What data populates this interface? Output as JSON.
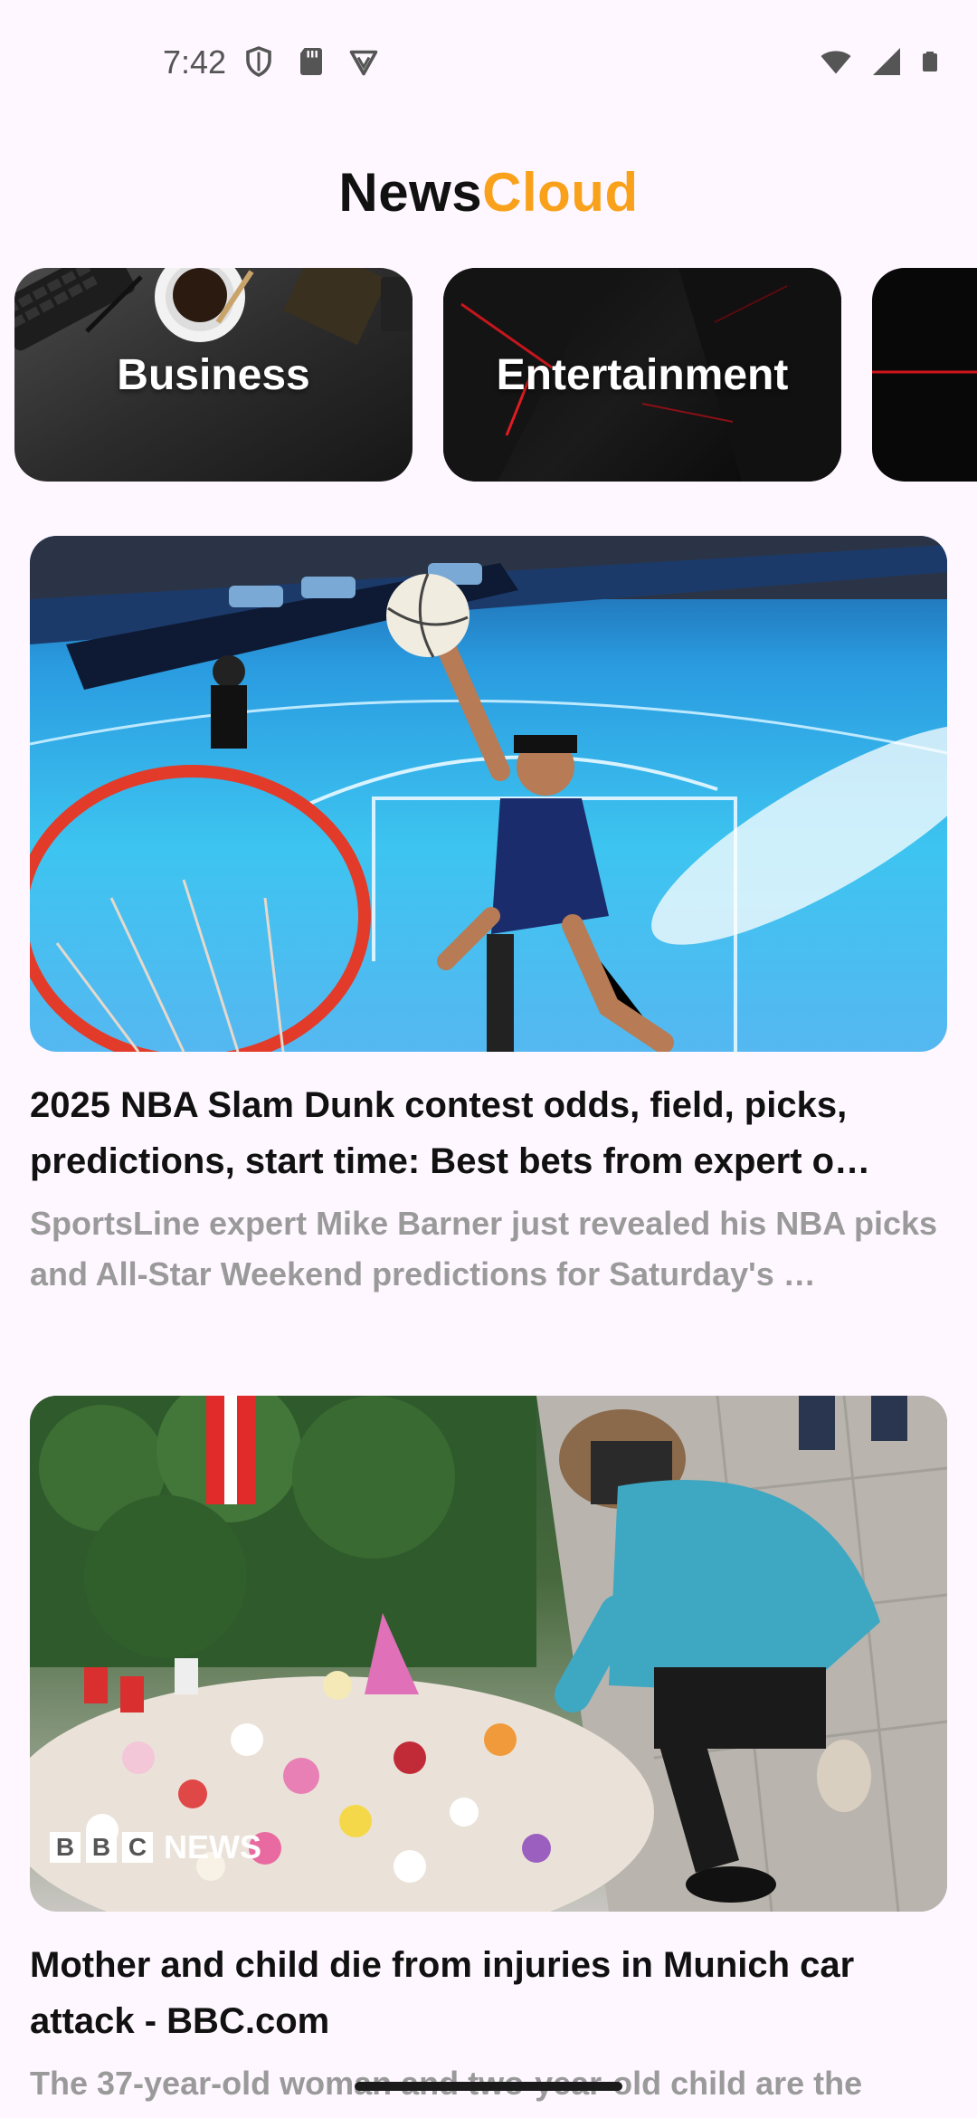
{
  "status_bar": {
    "time": "7:42",
    "left_icons": [
      "shield-icon",
      "sd-card-icon",
      "vpn-badge-icon"
    ],
    "right_icons": [
      "wifi-icon",
      "cellular-signal-icon",
      "battery-icon"
    ]
  },
  "app": {
    "title_part1": "News",
    "title_part2": "Cloud",
    "accent_color": "#F9A11B"
  },
  "categories": [
    {
      "label": "Business"
    },
    {
      "label": "Entertainment"
    },
    {
      "label": ""
    }
  ],
  "articles": [
    {
      "title": "2025 NBA Slam Dunk contest odds, field, picks, predictions, start time: Best bets from expert o…",
      "description": "SportsLine expert Mike Barner just revealed his NBA picks and All-Star Weekend predictions for Saturday's …",
      "image_icon": "basketball-dunk-photo"
    },
    {
      "title": "Mother and child die from injuries in Munich car attack - BBC.com",
      "description": "The 37-year-old woman and two-year-old child are the",
      "image_icon": "memorial-flowers-photo",
      "watermark": "BBC NEWS"
    }
  ]
}
